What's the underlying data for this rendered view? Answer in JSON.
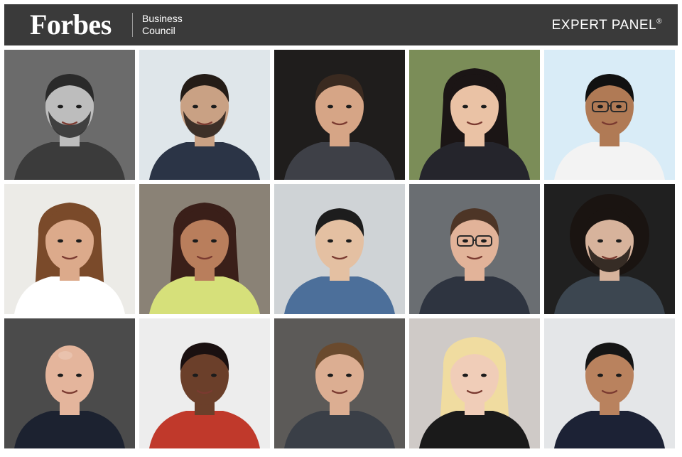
{
  "header": {
    "logo_text": "Forbes",
    "sub_line1": "Business",
    "sub_line2": "Council",
    "panel_text": "EXPERT PANEL",
    "panel_mark": "®",
    "bg_color": "#3a3a3a"
  },
  "grid": {
    "highlight_color": "#1a5aa6",
    "portraits": [
      {
        "bg": "#6b6b6b",
        "skin": "#bdbdbd",
        "hair": "#2a2a2a",
        "shirt": "#3b3b3b",
        "hair_style": "short",
        "beard": true,
        "bald": false,
        "glasses": false
      },
      {
        "bg": "#dfe6ea",
        "skin": "#c9a184",
        "hair": "#241c17",
        "shirt": "#2b3446",
        "hair_style": "short",
        "beard": true,
        "bald": false,
        "glasses": false
      },
      {
        "bg": "#1f1d1c",
        "skin": "#d6a586",
        "hair": "#3a2a20",
        "shirt": "#3e4047",
        "hair_style": "short",
        "beard": false,
        "bald": false,
        "glasses": false
      },
      {
        "bg": "#7b8d58",
        "skin": "#eac2a5",
        "hair": "#1b1515",
        "shirt": "#25252c",
        "hair_style": "long",
        "beard": false,
        "bald": false,
        "glasses": false
      },
      {
        "bg": "#d9ecf7",
        "skin": "#b07a55",
        "hair": "#111111",
        "shirt": "#f3f3f3",
        "hair_style": "short",
        "beard": false,
        "bald": false,
        "glasses": true,
        "highlight": true
      },
      {
        "bg": "#ecebe7",
        "skin": "#dcaa8b",
        "hair": "#7a4a2a",
        "shirt": "#ffffff",
        "hair_style": "long",
        "beard": false,
        "bald": false,
        "glasses": false
      },
      {
        "bg": "#8a8276",
        "skin": "#b97e5c",
        "hair": "#3a1f19",
        "shirt": "#d6e07a",
        "hair_style": "long",
        "beard": false,
        "bald": false,
        "glasses": false
      },
      {
        "bg": "#cfd3d6",
        "skin": "#e4c0a2",
        "hair": "#1d1d1d",
        "shirt": "#4c6f9a",
        "hair_style": "short",
        "beard": false,
        "bald": false,
        "glasses": false
      },
      {
        "bg": "#6a6e72",
        "skin": "#e2b399",
        "hair": "#4d3526",
        "shirt": "#2e3440",
        "hair_style": "short",
        "beard": false,
        "bald": false,
        "glasses": true
      },
      {
        "bg": "#202020",
        "skin": "#d7b39c",
        "hair": "#1a1411",
        "shirt": "#3c4650",
        "hair_style": "curly",
        "beard": true,
        "bald": false,
        "glasses": false
      },
      {
        "bg": "#4b4b4b",
        "skin": "#e4b59c",
        "hair": "#e4b59c",
        "shirt": "#1c2230",
        "hair_style": "none",
        "beard": false,
        "bald": true,
        "glasses": false
      },
      {
        "bg": "#ededed",
        "skin": "#6b3f2a",
        "hair": "#1a1010",
        "shirt": "#c0392b",
        "hair_style": "short",
        "beard": false,
        "bald": false,
        "glasses": false
      },
      {
        "bg": "#5c5a58",
        "skin": "#dcae92",
        "hair": "#6a4a2e",
        "shirt": "#3a3f47",
        "hair_style": "short",
        "beard": false,
        "bald": false,
        "glasses": false
      },
      {
        "bg": "#cfcac7",
        "skin": "#f0cdb8",
        "hair": "#f0dca0",
        "shirt": "#1a1a1a",
        "hair_style": "long",
        "beard": false,
        "bald": false,
        "glasses": false
      },
      {
        "bg": "#e4e6e8",
        "skin": "#b9825e",
        "hair": "#151515",
        "shirt": "#1c2235",
        "hair_style": "short",
        "beard": false,
        "bald": false,
        "glasses": false
      }
    ]
  }
}
